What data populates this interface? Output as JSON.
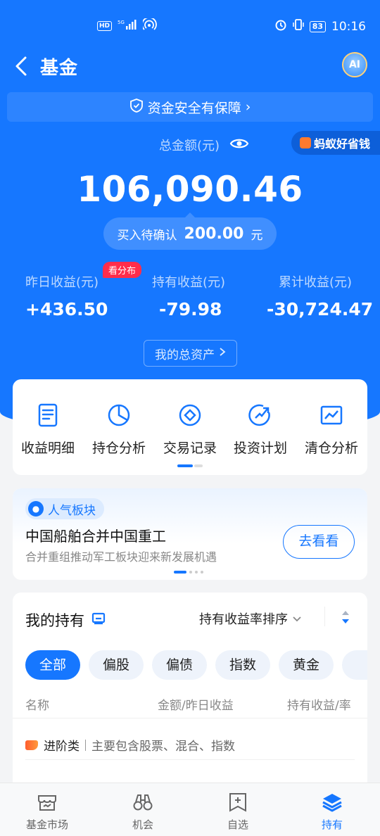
{
  "status_bar": {
    "network": "HD",
    "signal": "5G",
    "time": "10:16",
    "battery": "83"
  },
  "nav": {
    "title": "基金",
    "ai_label": "AI"
  },
  "safety_banner": {
    "text": "资金安全有保障",
    "chevron": "›"
  },
  "summary": {
    "total_label": "总金额(元)",
    "total_amount": "106,090.46",
    "ant_badge": "蚂蚁好省钱",
    "pending_label": "买入待确认",
    "pending_amount": "200.00",
    "pending_unit": "元",
    "distribution_tag": "看分布",
    "stats": [
      {
        "label": "昨日收益(元)",
        "value": "+436.50"
      },
      {
        "label": "持有收益(元)",
        "value": "-79.98"
      },
      {
        "label": "累计收益(元)",
        "value": "-30,724.47"
      }
    ],
    "assets_button": "我的总资产"
  },
  "quick_actions": [
    {
      "label": "收益明细",
      "icon": "document-icon"
    },
    {
      "label": "持仓分析",
      "icon": "pie-chart-icon"
    },
    {
      "label": "交易记录",
      "icon": "diamond-record-icon"
    },
    {
      "label": "投资计划",
      "icon": "growth-arrow-icon"
    },
    {
      "label": "清仓分析",
      "icon": "line-chart-icon"
    }
  ],
  "promo": {
    "tag": "人气板块",
    "title": "中国船舶合并中国重工",
    "subtitle": "合并重组推动军工板块迎来新发展机遇",
    "button": "去看看"
  },
  "holdings": {
    "title": "我的持有",
    "sort_label": "持有收益率排序",
    "chips": [
      "全部",
      "偏股",
      "偏债",
      "指数",
      "黄金"
    ],
    "columns": [
      "名称",
      "金额/昨日收益",
      "持有收益/率"
    ],
    "category": {
      "name": "进阶类",
      "description": "主要包含股票、混合、指数"
    }
  },
  "tab_bar": [
    {
      "label": "基金市场",
      "icon": "fund-market-icon",
      "active": false
    },
    {
      "label": "机会",
      "icon": "binoculars-icon",
      "active": false
    },
    {
      "label": "自选",
      "icon": "add-favorite-icon",
      "active": false
    },
    {
      "label": "持有",
      "icon": "layers-icon",
      "active": true
    }
  ],
  "colors": {
    "primary": "#1677ff",
    "badge_red": "#ff2d4b",
    "background": "#f3f4f6"
  }
}
